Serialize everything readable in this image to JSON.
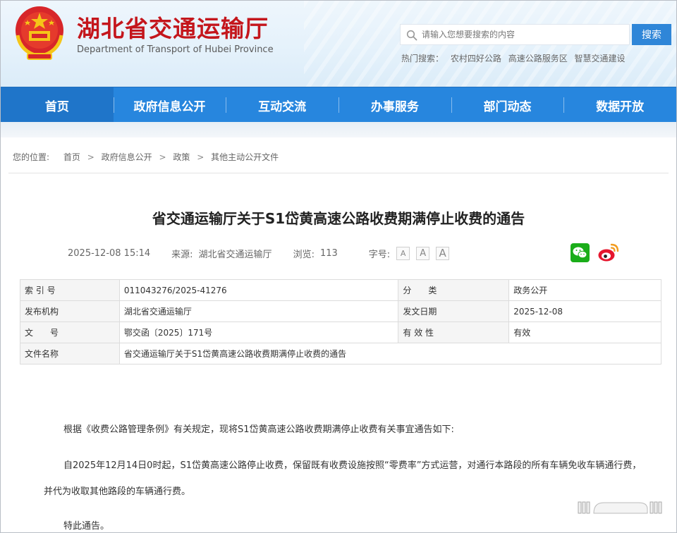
{
  "header": {
    "title": "湖北省交通运输厅",
    "subtitle": "Department of Transport of Hubei Province",
    "search": {
      "placeholder": "请输入您想要搜索的内容",
      "button_label": "搜索"
    },
    "hot_search": {
      "label": "热门搜索：",
      "items": [
        "农村四好公路",
        "高速公路服务区",
        "智慧交通建设"
      ]
    }
  },
  "nav": {
    "items": [
      "首页",
      "政府信息公开",
      "互动交流",
      "办事服务",
      "部门动态",
      "数据开放"
    ],
    "active_index": 0
  },
  "breadcrumb": {
    "label": "您的位置:",
    "items": [
      "首页",
      "政府信息公开",
      "政策",
      "其他主动公开文件"
    ],
    "separator": ">"
  },
  "article": {
    "title": "省交通运输厅关于S1岱黄高速公路收费期满停止收费的通告",
    "date": "2025-12-08 15:14",
    "source_label": "来源:",
    "source": "湖北省交通运输厅",
    "views_label": "浏览:",
    "views": "113",
    "font_size_label": "字号:",
    "font_buttons": [
      "A",
      "A",
      "A"
    ],
    "share": [
      "wechat-icon",
      "weibo-icon"
    ]
  },
  "info_table": {
    "rows": [
      {
        "k1": "索 引 号",
        "v1": "011043276/2025-41276",
        "k2": "分　　类",
        "v2": "政务公开"
      },
      {
        "k1": "发布机构",
        "v1": "湖北省交通运输厅",
        "k2": "发文日期",
        "v2": "2025-12-08"
      },
      {
        "k1": "文　　号",
        "v1": "鄂交函〔2025〕171号",
        "k2": "有 效 性",
        "v2": "有效"
      }
    ],
    "file_name_label": "文件名称",
    "file_name": "省交通运输厅关于S1岱黄高速公路收费期满停止收费的通告"
  },
  "body": {
    "p1": "根据《收费公路管理条例》有关规定，现将S1岱黄高速公路收费期满停止收费有关事宜通告如下:",
    "p2_line1": "自2025年12月14日0时起，S1岱黄高速公路停止收费，保留既有收费设施按照“零费率”方式运营，对通行本路段的所有车辆免收车辆通行费，",
    "p2_line2": "并代为收取其他路段的车辆通行费。",
    "p3": "特此通告。"
  },
  "colors": {
    "brand_red": "#c4161c",
    "nav_blue": "#2786de",
    "button_blue": "#2f86d8"
  }
}
